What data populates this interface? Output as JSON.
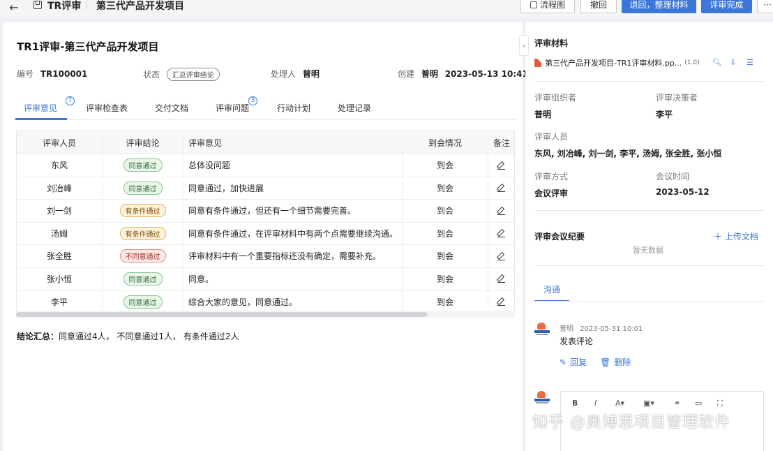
{
  "topbar": {
    "crumb_1": "TR评审",
    "crumb_2": "第三代产品开发项目",
    "flow_label": "流程图",
    "undo_label": "撤回",
    "return_label": "退回，整理材料",
    "complete_label": "评审完成",
    "more_label": "···"
  },
  "header": {
    "title": "TR1评审-第三代产品开发项目",
    "code_label": "编号",
    "code_value": "TR100001",
    "status_label": "状态",
    "status_value": "汇总评审结论",
    "handler_label": "处理人",
    "handler_value": "普明",
    "created_label": "创建",
    "created_by": "普明",
    "created_at": "2023-05-13 10:41"
  },
  "tabs": [
    {
      "label": "评审意见",
      "count": "7"
    },
    {
      "label": "评审检查表"
    },
    {
      "label": "交付文档"
    },
    {
      "label": "评审问题",
      "count": "3"
    },
    {
      "label": "行动计划"
    },
    {
      "label": "处理记录"
    }
  ],
  "table": {
    "headers": [
      "评审人员",
      "评审结论",
      "评审意见",
      "到会情况",
      "备注"
    ],
    "rows": [
      {
        "reviewer": "东风",
        "conclusion": "同意通过",
        "status": "pass",
        "opinion": "总体没问题",
        "attendance": "到会"
      },
      {
        "reviewer": "刘冶峰",
        "conclusion": "同意通过",
        "status": "pass",
        "opinion": "同意通过，加快进展",
        "attendance": "到会"
      },
      {
        "reviewer": "刘一剑",
        "conclusion": "有条件通过",
        "status": "cond",
        "opinion": "同意有条件通过，但还有一个细节需要完善。",
        "attendance": "到会"
      },
      {
        "reviewer": "汤姆",
        "conclusion": "有条件通过",
        "status": "cond",
        "opinion": "同意有条件通过，在评审材料中有两个点需要继续沟通。",
        "attendance": "到会"
      },
      {
        "reviewer": "张全胜",
        "conclusion": "不同意通过",
        "status": "fail",
        "opinion": "评审材料中有一个重要指标还没有确定，需要补充。",
        "attendance": "到会"
      },
      {
        "reviewer": "张小恒",
        "conclusion": "同意通过",
        "status": "pass",
        "opinion": "同意。",
        "attendance": "到会"
      },
      {
        "reviewer": "李平",
        "conclusion": "同意通过",
        "status": "pass",
        "opinion": "综合大家的意见，同意通过。",
        "attendance": "到会"
      }
    ]
  },
  "summary": {
    "label": "结论汇总：",
    "text": "同意通过4人， 不同意通过1人， 有条件通过2人"
  },
  "right": {
    "materials_title": "评审材料",
    "file_name": "第三代产品开发项目-TR1评审材料.pp...",
    "file_version": "(1.0)",
    "organizer_label": "评审组织者",
    "organizer_value": "普明",
    "decider_label": "评审决策者",
    "decider_value": "李平",
    "members_label": "评审人员",
    "members_value": "东风, 刘冶峰, 刘一剑, 李平, 汤姆, 张全胜, 张小恒",
    "method_label": "评审方式",
    "method_value": "会议评审",
    "meeting_time_label": "会议时间",
    "meeting_time_value": "2023-05-12",
    "minutes_title": "评审会议纪要",
    "upload_label": "上传文档",
    "empty_label": "暂无数据",
    "comm_tab": "沟通",
    "comment_author": "普明",
    "comment_time": "2023-05-31 10:01",
    "comment_text": "发表评论",
    "reply_label": "回复",
    "delete_label": "删除"
  },
  "watermark": "知乎 @奥博思项目管理软件",
  "colors": {
    "accent": "#3b76d8",
    "pass": "#2e6a35",
    "conditional": "#7a4d0a",
    "fail": "#9a2c22"
  }
}
